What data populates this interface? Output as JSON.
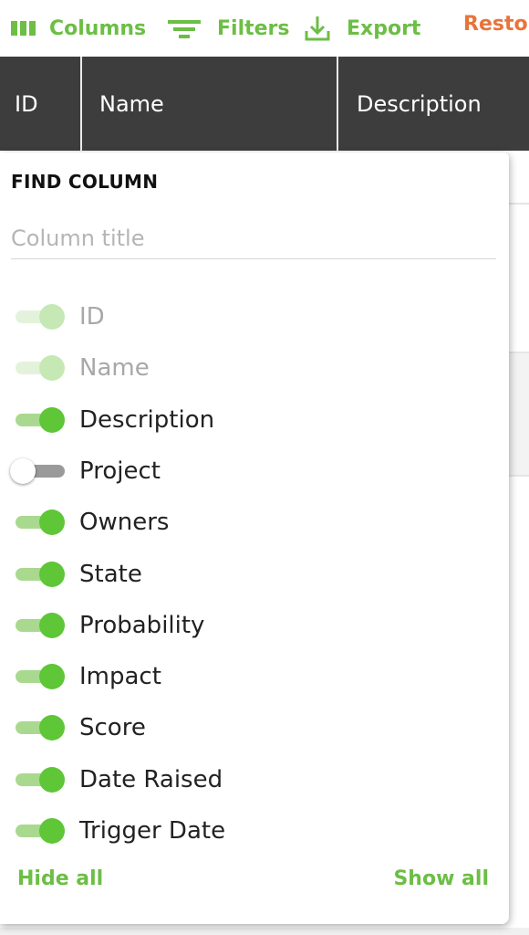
{
  "toolbar": {
    "columns_label": "Columns",
    "filters_label": "Filters",
    "export_label": "Export",
    "restore_label": "Restore",
    "accent_color": "#6cbe45",
    "restore_color": "#e8743b"
  },
  "grid_header": {
    "columns": [
      "ID",
      "Name",
      "Description"
    ],
    "background": "#3d3d3d"
  },
  "column_panel": {
    "title": "FIND COLUMN",
    "search_placeholder": "Column title",
    "columns": [
      {
        "label": "ID",
        "visible": true,
        "disabled": true
      },
      {
        "label": "Name",
        "visible": true,
        "disabled": true
      },
      {
        "label": "Description",
        "visible": true,
        "disabled": false
      },
      {
        "label": "Project",
        "visible": false,
        "disabled": false
      },
      {
        "label": "Owners",
        "visible": true,
        "disabled": false
      },
      {
        "label": "State",
        "visible": true,
        "disabled": false
      },
      {
        "label": "Probability",
        "visible": true,
        "disabled": false
      },
      {
        "label": "Impact",
        "visible": true,
        "disabled": false
      },
      {
        "label": "Score",
        "visible": true,
        "disabled": false
      },
      {
        "label": "Date Raised",
        "visible": true,
        "disabled": false
      },
      {
        "label": "Trigger Date",
        "visible": true,
        "disabled": false
      }
    ],
    "hide_all_label": "Hide all",
    "show_all_label": "Show all"
  }
}
